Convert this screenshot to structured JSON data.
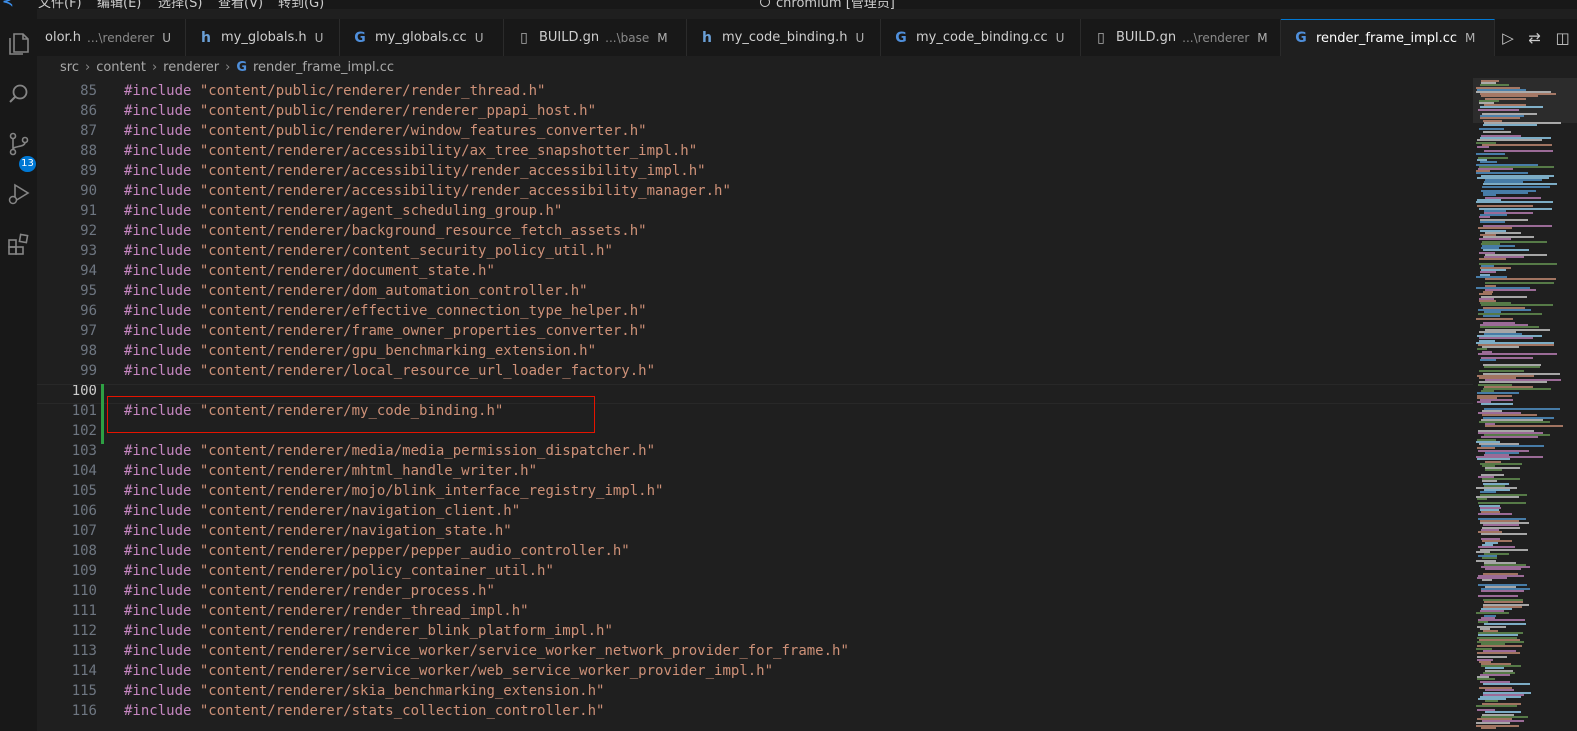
{
  "menu": {
    "items": [
      "文件(F)",
      "编辑(E)",
      "选择(S)",
      "查看(V)",
      "转到(G)"
    ],
    "command_center": "chromium [管理员]"
  },
  "activity": {
    "source_control_badge": "13"
  },
  "tabs": [
    {
      "icon": "c-header-icon",
      "label": "olor.h",
      "dir": "...\\renderer",
      "status": "U",
      "active": false
    },
    {
      "icon": "h-file-icon",
      "label": "my_globals.h",
      "dir": "",
      "status": "U",
      "active": false
    },
    {
      "icon": "cpp-file-icon",
      "label": "my_globals.cc",
      "dir": "",
      "status": "U",
      "active": false
    },
    {
      "icon": "file-icon",
      "label": "BUILD.gn",
      "dir": "...\\base",
      "status": "M",
      "active": false
    },
    {
      "icon": "h-file-icon",
      "label": "my_code_binding.h",
      "dir": "",
      "status": "U",
      "active": false
    },
    {
      "icon": "cpp-file-icon",
      "label": "my_code_binding.cc",
      "dir": "",
      "status": "U",
      "active": false
    },
    {
      "icon": "file-icon",
      "label": "BUILD.gn",
      "dir": "...\\renderer",
      "status": "M",
      "active": false
    },
    {
      "icon": "cpp-file-icon",
      "label": "render_frame_impl.cc",
      "dir": "",
      "status": "M",
      "active": true
    }
  ],
  "breadcrumb": {
    "parts": [
      "src",
      "content",
      "renderer"
    ],
    "file": "render_frame_impl.cc"
  },
  "editor": {
    "current_line": 100,
    "highlighted_line": 101,
    "lines": [
      {
        "n": "85",
        "kw": "#include",
        "path": "\"content/public/renderer/render_thread.h\""
      },
      {
        "n": "86",
        "kw": "#include",
        "path": "\"content/public/renderer/renderer_ppapi_host.h\""
      },
      {
        "n": "87",
        "kw": "#include",
        "path": "\"content/public/renderer/window_features_converter.h\""
      },
      {
        "n": "88",
        "kw": "#include",
        "path": "\"content/renderer/accessibility/ax_tree_snapshotter_impl.h\""
      },
      {
        "n": "89",
        "kw": "#include",
        "path": "\"content/renderer/accessibility/render_accessibility_impl.h\""
      },
      {
        "n": "90",
        "kw": "#include",
        "path": "\"content/renderer/accessibility/render_accessibility_manager.h\""
      },
      {
        "n": "91",
        "kw": "#include",
        "path": "\"content/renderer/agent_scheduling_group.h\""
      },
      {
        "n": "92",
        "kw": "#include",
        "path": "\"content/renderer/background_resource_fetch_assets.h\""
      },
      {
        "n": "93",
        "kw": "#include",
        "path": "\"content/renderer/content_security_policy_util.h\""
      },
      {
        "n": "94",
        "kw": "#include",
        "path": "\"content/renderer/document_state.h\""
      },
      {
        "n": "95",
        "kw": "#include",
        "path": "\"content/renderer/dom_automation_controller.h\""
      },
      {
        "n": "96",
        "kw": "#include",
        "path": "\"content/renderer/effective_connection_type_helper.h\""
      },
      {
        "n": "97",
        "kw": "#include",
        "path": "\"content/renderer/frame_owner_properties_converter.h\""
      },
      {
        "n": "98",
        "kw": "#include",
        "path": "\"content/renderer/gpu_benchmarking_extension.h\""
      },
      {
        "n": "99",
        "kw": "#include",
        "path": "\"content/renderer/local_resource_url_loader_factory.h\""
      },
      {
        "n": "100",
        "kw": "",
        "path": ""
      },
      {
        "n": "101",
        "kw": "#include",
        "path": "\"content/renderer/my_code_binding.h\""
      },
      {
        "n": "102",
        "kw": "",
        "path": ""
      },
      {
        "n": "103",
        "kw": "#include",
        "path": "\"content/renderer/media/media_permission_dispatcher.h\""
      },
      {
        "n": "104",
        "kw": "#include",
        "path": "\"content/renderer/mhtml_handle_writer.h\""
      },
      {
        "n": "105",
        "kw": "#include",
        "path": "\"content/renderer/mojo/blink_interface_registry_impl.h\""
      },
      {
        "n": "106",
        "kw": "#include",
        "path": "\"content/renderer/navigation_client.h\""
      },
      {
        "n": "107",
        "kw": "#include",
        "path": "\"content/renderer/navigation_state.h\""
      },
      {
        "n": "108",
        "kw": "#include",
        "path": "\"content/renderer/pepper/pepper_audio_controller.h\""
      },
      {
        "n": "109",
        "kw": "#include",
        "path": "\"content/renderer/policy_container_util.h\""
      },
      {
        "n": "110",
        "kw": "#include",
        "path": "\"content/renderer/render_process.h\""
      },
      {
        "n": "111",
        "kw": "#include",
        "path": "\"content/renderer/render_thread_impl.h\""
      },
      {
        "n": "112",
        "kw": "#include",
        "path": "\"content/renderer/renderer_blink_platform_impl.h\""
      },
      {
        "n": "113",
        "kw": "#include",
        "path": "\"content/renderer/service_worker/service_worker_network_provider_for_frame.h\""
      },
      {
        "n": "114",
        "kw": "#include",
        "path": "\"content/renderer/service_worker/web_service_worker_provider_impl.h\""
      },
      {
        "n": "115",
        "kw": "#include",
        "path": "\"content/renderer/skia_benchmarking_extension.h\""
      },
      {
        "n": "116",
        "kw": "#include",
        "path": "\"content/renderer/stats_collection_controller.h\""
      }
    ]
  },
  "colors": {
    "keyword": "#c586c0",
    "string": "#ce9178",
    "accent": "#0078d4",
    "highlight_box": "#e51400",
    "git_added": "#2ea043"
  }
}
